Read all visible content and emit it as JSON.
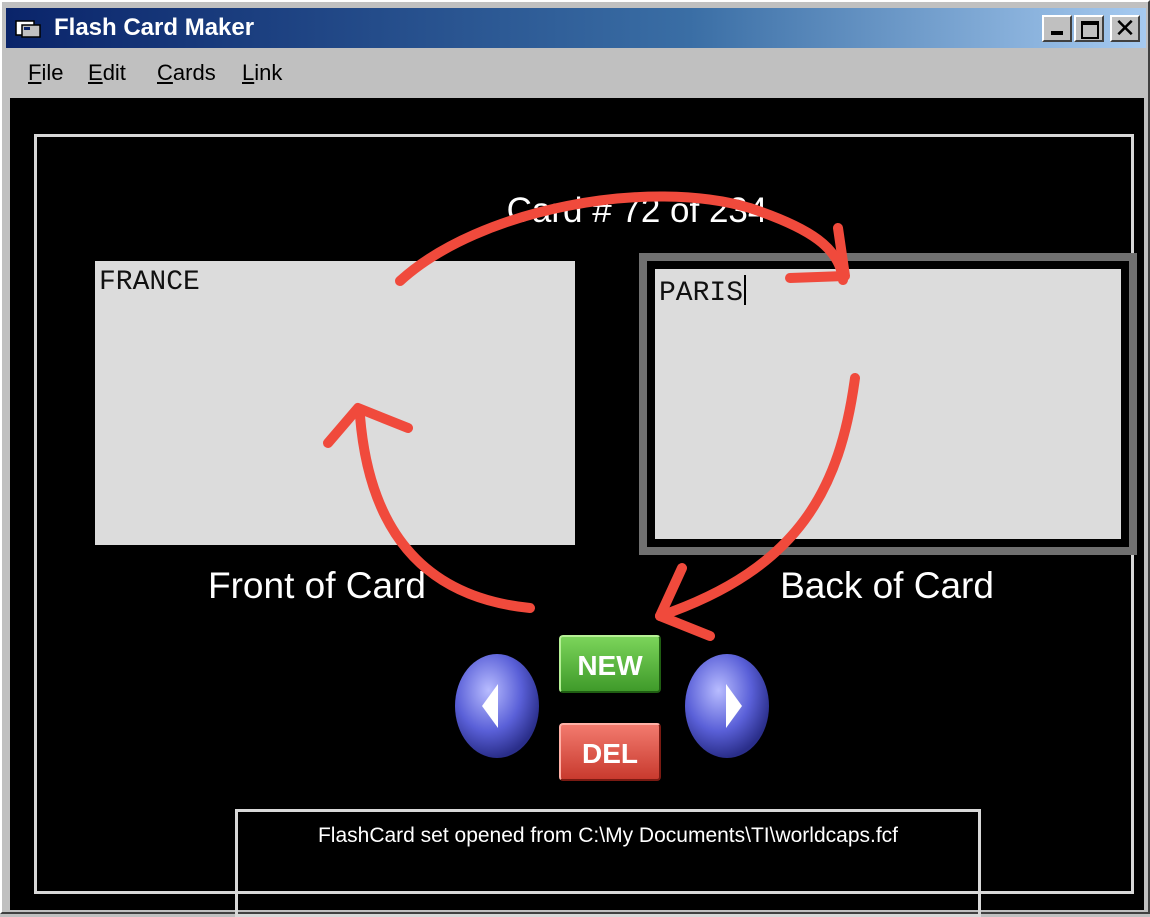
{
  "window": {
    "title": "Flash Card Maker",
    "icon": "app-icon",
    "controls": [
      "minimize-icon",
      "maximize-icon",
      "close-icon"
    ],
    "close_glyph": "✕"
  },
  "menu": [
    {
      "label": "File"
    },
    {
      "label": "Edit"
    },
    {
      "label": "Cards"
    },
    {
      "label": "Link"
    }
  ],
  "card": {
    "counter": "Card # 72 of 234",
    "front_text": "FRANCE",
    "back_text": "PARIS",
    "front_caption": "Front of Card",
    "back_caption": "Back of Card"
  },
  "buttons": {
    "new_label": "NEW",
    "del_label": "DEL",
    "prev_icon": "left-arrow-icon",
    "next_icon": "right-arrow-icon"
  },
  "status": {
    "message": "FlashCard set opened from C:\\My Documents\\TI\\worldcaps.fcf"
  },
  "colors": {
    "titlebar_start": "#0a246a",
    "titlebar_end": "#a6caf0",
    "background": "#000000",
    "card_face": "#dcdcdc",
    "new_button": "#4caf35",
    "del_button": "#e0483c",
    "annotation_arrows": "#f04a3c"
  }
}
